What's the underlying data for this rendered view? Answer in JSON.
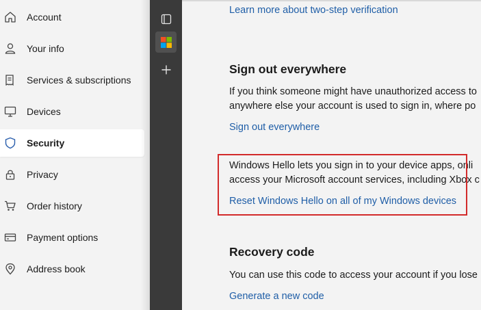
{
  "nav": {
    "items": [
      {
        "label": "Account",
        "icon": "home-icon"
      },
      {
        "label": "Your info",
        "icon": "person-icon"
      },
      {
        "label": "Services & subscriptions",
        "icon": "receipt-icon"
      },
      {
        "label": "Devices",
        "icon": "monitor-icon"
      },
      {
        "label": "Security",
        "icon": "shield-icon",
        "active": true
      },
      {
        "label": "Privacy",
        "icon": "lock-icon"
      },
      {
        "label": "Order history",
        "icon": "cart-icon"
      },
      {
        "label": "Payment options",
        "icon": "credit-card-icon"
      },
      {
        "label": "Address book",
        "icon": "location-pin-icon"
      }
    ]
  },
  "sidebar": {
    "buttons": [
      "tab-actions-icon",
      "microsoft-logo-icon",
      "plus-icon"
    ]
  },
  "content": {
    "two_step_link": "Learn more about two-step verification",
    "sign_out": {
      "heading": "Sign out everywhere",
      "text_line1": "If you think someone might have unauthorized access to",
      "text_line2": "anywhere else your account is used to sign in, where po",
      "link": "Sign out everywhere"
    },
    "hello": {
      "text_line1": "Windows Hello lets you sign in to your device apps, onli",
      "text_line2": "access your Microsoft account services, including Xbox c",
      "link": "Reset Windows Hello on all of my Windows devices"
    },
    "recovery": {
      "heading": "Recovery code",
      "text_line1": "You can use this code to access your account if you lose",
      "link": "Generate a new code"
    }
  },
  "colors": {
    "link": "#1f5ea7",
    "highlight": "#d22a2a",
    "sidebar": "#3a3a3a"
  }
}
